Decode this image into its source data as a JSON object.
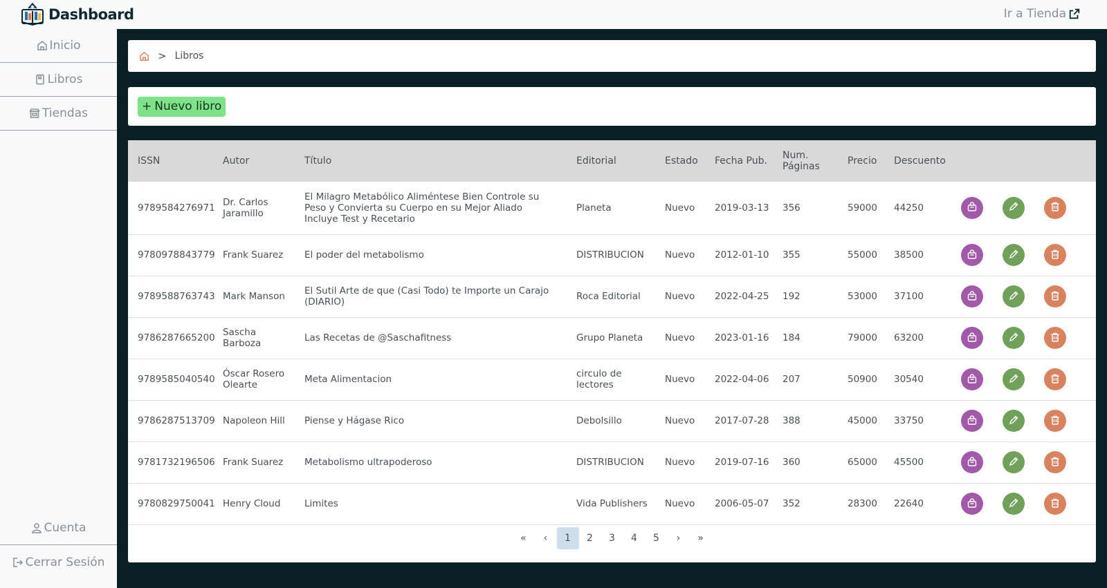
{
  "brand": {
    "title": "Dashboard"
  },
  "header": {
    "store_link": "Ir a Tienda"
  },
  "sidebar": {
    "items": [
      {
        "label": "Inicio",
        "icon": "home-icon"
      },
      {
        "label": "Libros",
        "icon": "book-icon"
      },
      {
        "label": "Tiendas",
        "icon": "store-icon"
      }
    ],
    "bottom": [
      {
        "label": "Cuenta",
        "icon": "user-icon"
      },
      {
        "label": "Cerrar Sesión",
        "icon": "logout-icon"
      }
    ]
  },
  "breadcrumb": {
    "current": "Libros"
  },
  "toolbar": {
    "new_label": "Nuevo libro"
  },
  "table": {
    "headers": [
      "ISSN",
      "Autor",
      "Título",
      "Editorial",
      "Estado",
      "Fecha Pub.",
      "Num. Páginas",
      "Precio",
      "Descuento"
    ],
    "rows": [
      [
        "9789584276971",
        "Dr. Carlos Jaramillo",
        "El Milagro Metabólico Aliméntese Bien Controle su Peso y Convierta su Cuerpo en su Mejor Aliado Incluye Test y Recetario",
        "Planeta",
        "Nuevo",
        "2019-03-13",
        "356",
        "59000",
        "44250"
      ],
      [
        "9780978843779",
        "Frank Suarez",
        "El poder del metabolismo",
        "DISTRIBUCION",
        "Nuevo",
        "2012-01-10",
        "355",
        "55000",
        "38500"
      ],
      [
        "9789588763743",
        "Mark Manson",
        "El Sutil Arte de que (Casi Todo) te Importe un Carajo (DIARIO)",
        "Roca Editorial",
        "Nuevo",
        "2022-04-25",
        "192",
        "53000",
        "37100"
      ],
      [
        "9786287665200",
        "Sascha Barboza",
        "Las Recetas de @Saschafitness",
        "Grupo Planeta",
        "Nuevo",
        "2023-01-16",
        "184",
        "79000",
        "63200"
      ],
      [
        "9789585040540",
        "Óscar Rosero Olearte",
        "Meta Alimentacion",
        "circulo de lectores",
        "Nuevo",
        "2022-04-06",
        "207",
        "50900",
        "30540"
      ],
      [
        "9786287513709",
        "Napoleon Hill",
        "Piense y Hágase Rico",
        "Debolsillo",
        "Nuevo",
        "2017-07-28",
        "388",
        "45000",
        "33750"
      ],
      [
        "9781732196506",
        "Frank Suarez",
        "Metabolismo ultrapoderoso",
        "DISTRIBUCION",
        "Nuevo",
        "2019-07-16",
        "360",
        "65000",
        "45500"
      ],
      [
        "9780829750041",
        "Henry Cloud",
        "Limites",
        "Vida Publishers",
        "Nuevo",
        "2006-05-07",
        "352",
        "28300",
        "22640"
      ]
    ]
  },
  "pagination": {
    "first": "«",
    "prev": "‹",
    "next": "›",
    "last": "»",
    "pages": [
      "1",
      "2",
      "3",
      "4",
      "5"
    ],
    "current": "1"
  },
  "colors": {
    "main_bg": "#0a2025",
    "buy": "#a05aa8",
    "edit": "#6fa15b",
    "delete": "#d8825f",
    "new_button": "#7ee28a"
  }
}
